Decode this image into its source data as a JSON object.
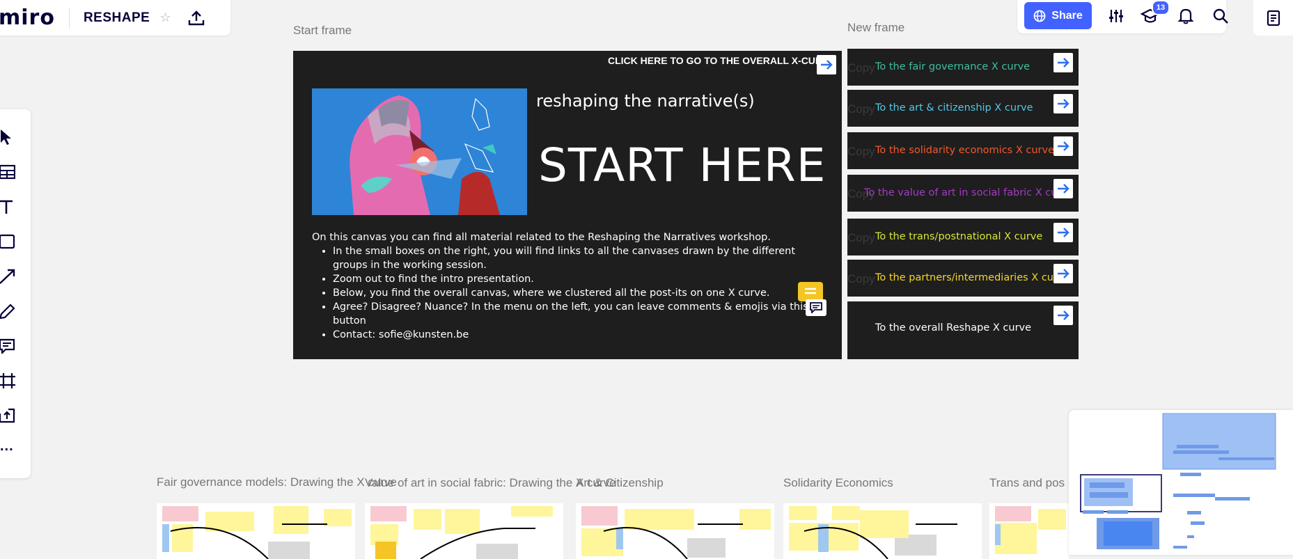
{
  "header": {
    "logo": "miro",
    "board_name": "RESHAPE",
    "share_label": "Share",
    "notification_count": "13",
    "icons": [
      "star-icon",
      "upload-icon",
      "globe-icon",
      "settings-sliders-icon",
      "learning-cap-icon",
      "bell-icon",
      "search-icon",
      "notes-icon"
    ]
  },
  "toolbar": {
    "tools": [
      "select-icon",
      "templates-icon",
      "text-icon",
      "shape-icon",
      "connector-icon",
      "pen-icon",
      "comment-icon",
      "frame-icon",
      "upload-icon",
      "more-icon"
    ],
    "more_label": "..."
  },
  "start_frame": {
    "label": "Start frame",
    "click_here": "CLICK HERE TO GO TO THE OVERALL X-CURVE",
    "subtitle": "reshaping the narrative(s)",
    "title": "START HERE",
    "intro": "On this canvas you can find all material related to the Reshaping the Narratives workshop.",
    "bullets": [
      "In the small boxes on the right, you will find links to all the canvases drawn by the different groups in the working session.",
      "Zoom out to find the intro presentation.",
      "Below, you find the overall canvas, where we clustered all the post-its on one X curve.",
      "Agree? Disagree? Nuance? In the menu on the left, you can leave comments & emojis via this button",
      "Contact: sofie@kunsten.be"
    ]
  },
  "new_frame": {
    "label": "New frame",
    "ghost_text": "Copy",
    "cards": [
      {
        "label": "To the fair governance X curve",
        "color": "#3fbf9f"
      },
      {
        "label": "To the art & citizenship X curve",
        "color": "#4fc8e8"
      },
      {
        "label": "To the solidarity economics X curve",
        "color": "#f05a2c"
      },
      {
        "label": "To the value of art in social fabric X curve",
        "color": "#a33cc4"
      },
      {
        "label": "To the trans/postnational X curve",
        "color": "#d7e63a"
      },
      {
        "label": "To the partners/intermediaries X curve",
        "color": "#f4d62a"
      },
      {
        "label": "To the overall Reshape X curve",
        "color": "#ffffff"
      }
    ]
  },
  "bottom_frames": [
    {
      "label": "Fair governance models: Drawing the X curve"
    },
    {
      "label": "Value of art in social fabric: Drawing the X curve"
    },
    {
      "label": "Art & Citizenship"
    },
    {
      "label": "Solidarity Economics"
    },
    {
      "label": "Trans and pos"
    }
  ]
}
